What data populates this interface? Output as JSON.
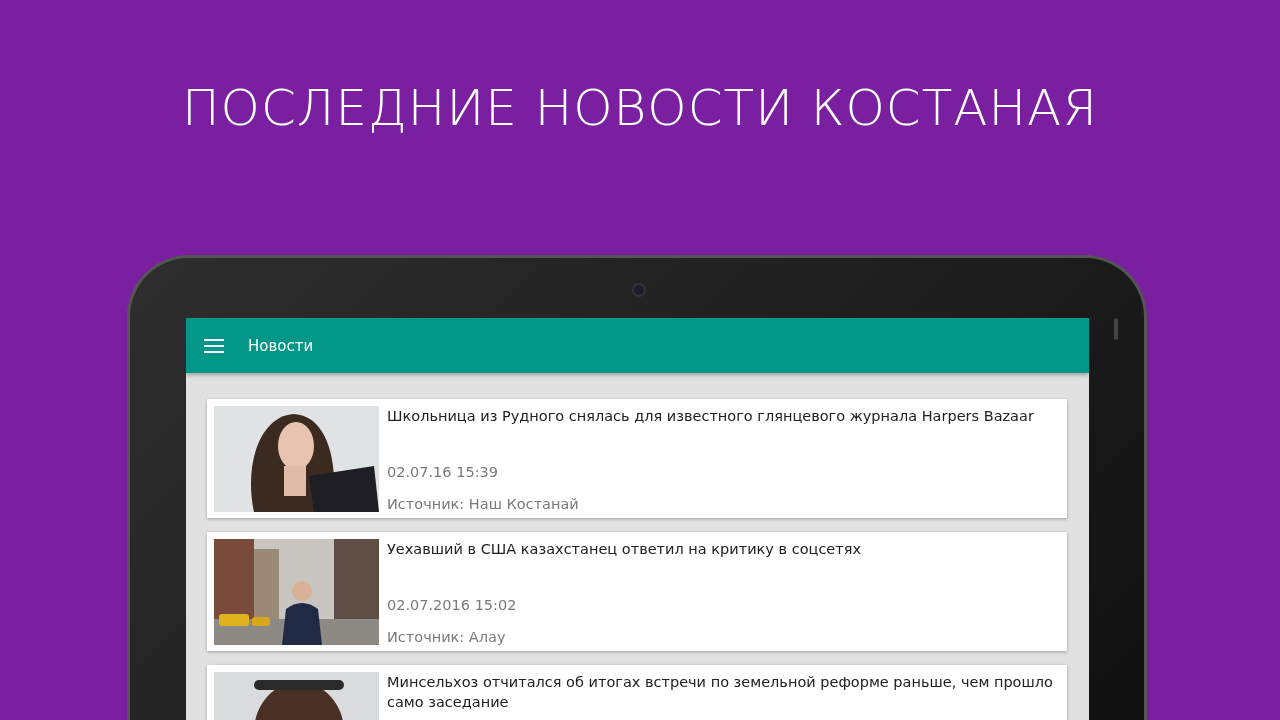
{
  "headline": "ПОСЛЕДНИЕ НОВОСТИ КОСТАНАЯ",
  "app_bar": {
    "title": "Новости"
  },
  "news": [
    {
      "title": " Школьница из Рудного снялась для известного глянцевого журнала Harpers Bazaar",
      "date": "02.07.16 15:39",
      "source": "Источник: Наш Костанай"
    },
    {
      "title": "Уехавший в США казахстанец ответил на критику в соцсетях",
      "date": "02.07.2016 15:02",
      "source": "Источник: Алау"
    },
    {
      "title": "Минсельхоз отчитался об итогах встречи по земельной реформе раньше, чем прошло само заседание"
    }
  ]
}
